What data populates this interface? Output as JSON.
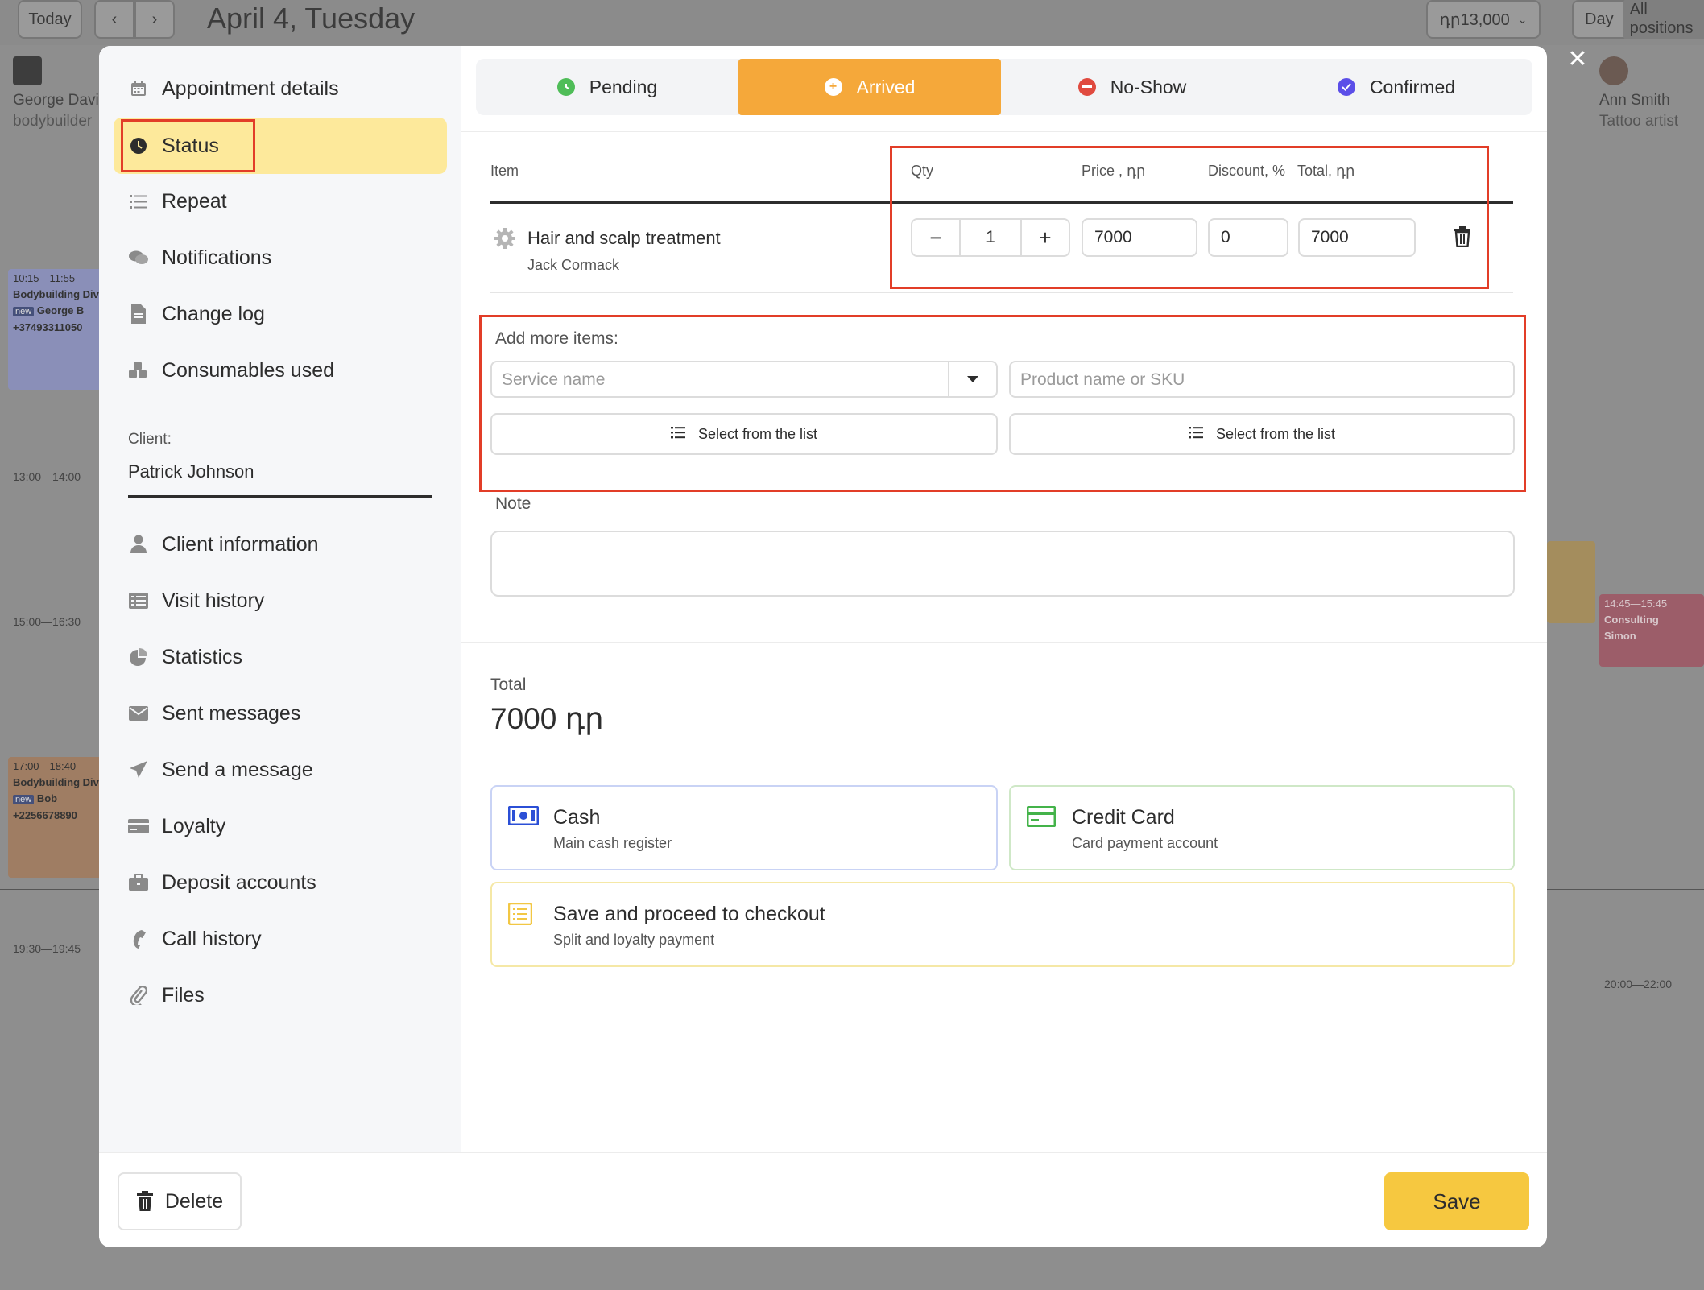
{
  "calendar": {
    "today_label": "Today",
    "prev_icon": "chevron-left-icon",
    "next_icon": "chevron-right-icon",
    "date_title": "April 4, Tuesday",
    "balance": "դր13,000",
    "view_label": "Day",
    "positions_label": "All positions",
    "staff": [
      {
        "name": "George Davis",
        "role": "bodybuilder"
      },
      {
        "name": "Ann Smith",
        "role": "Tattoo artist"
      }
    ],
    "appointments": [
      {
        "time": "10:15—11:55",
        "service": "Bodybuilding Div",
        "badge": "new",
        "client": "George B",
        "phone": "+37493311050"
      },
      {
        "time": "17:00—18:40",
        "service": "Bodybuilding Div",
        "badge": "new",
        "client": "Bob",
        "phone": "+2256678890"
      },
      {
        "time": "14:45—15:45",
        "service": "Consulting",
        "client": "Simon"
      }
    ],
    "time_labels": [
      "13:00—14:00",
      "15:00—16:30",
      "19:30—19:45",
      "20:00—22:00"
    ]
  },
  "sidebar": {
    "items": [
      {
        "label": "Appointment details",
        "icon": "calendar-icon"
      },
      {
        "label": "Status",
        "icon": "clock-icon"
      },
      {
        "label": "Repeat",
        "icon": "list-icon"
      },
      {
        "label": "Notifications",
        "icon": "chat-bubbles-icon"
      },
      {
        "label": "Change log",
        "icon": "document-icon"
      },
      {
        "label": "Consumables used",
        "icon": "boxes-icon"
      }
    ],
    "client_label": "Client:",
    "client_name": "Patrick Johnson",
    "client_items": [
      {
        "label": "Client information",
        "icon": "user-icon"
      },
      {
        "label": "Visit history",
        "icon": "table-icon"
      },
      {
        "label": "Statistics",
        "icon": "pie-chart-icon"
      },
      {
        "label": "Sent messages",
        "icon": "envelope-icon"
      },
      {
        "label": "Send a message",
        "icon": "paper-plane-icon"
      },
      {
        "label": "Loyalty",
        "icon": "card-icon"
      },
      {
        "label": "Deposit accounts",
        "icon": "briefcase-icon"
      },
      {
        "label": "Call history",
        "icon": "phone-icon"
      },
      {
        "label": "Files",
        "icon": "paperclip-icon"
      }
    ]
  },
  "status_tabs": [
    {
      "label": "Pending",
      "color": "#4fbd58"
    },
    {
      "label": "Arrived",
      "color": "#f5a83a",
      "active": true
    },
    {
      "label": "No-Show",
      "color": "#e04a3f"
    },
    {
      "label": "Confirmed",
      "color": "#5b4ee8"
    }
  ],
  "table": {
    "headers": {
      "item": "Item",
      "qty": "Qty",
      "price": "Price , դր",
      "discount": "Discount, %",
      "total": "Total, դր"
    },
    "rows": [
      {
        "name": "Hair and scalp treatment",
        "staff": "Jack Cormack",
        "qty": "1",
        "price": "7000",
        "discount": "0",
        "total": "7000"
      }
    ]
  },
  "add_items": {
    "label": "Add more items:",
    "service_placeholder": "Service name",
    "product_placeholder": "Product name or SKU",
    "select_list_label": "Select from the list"
  },
  "note": {
    "label": "Note",
    "value": ""
  },
  "totals": {
    "label": "Total",
    "value": "7000 դր"
  },
  "payment": {
    "cash": {
      "title": "Cash",
      "subtitle": "Main cash register"
    },
    "card": {
      "title": "Credit Card",
      "subtitle": "Card payment account"
    },
    "checkout": {
      "title": "Save and proceed to checkout",
      "subtitle": "Split and loyalty payment"
    }
  },
  "footer": {
    "delete_label": "Delete",
    "save_label": "Save"
  },
  "colors": {
    "accent": "#f6c840",
    "arrived": "#f5a83a",
    "highlight": "#e23d28"
  }
}
